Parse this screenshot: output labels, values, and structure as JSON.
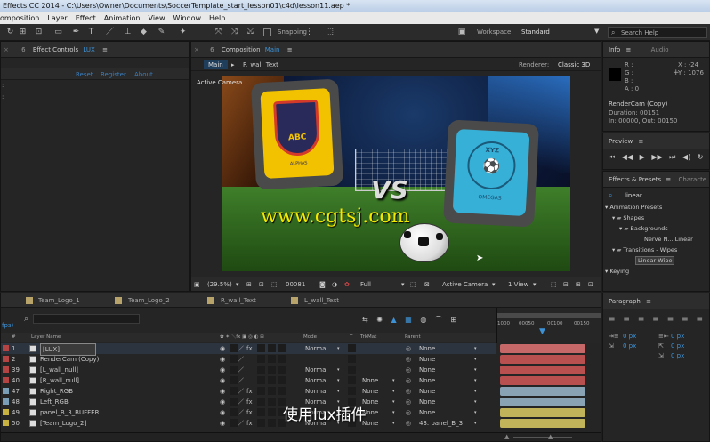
{
  "window": {
    "title": "Effects CC 2014 - C:\\Users\\Owner\\Documents\\SoccerTemplate_start_lesson01\\c4d\\lesson11.aep *"
  },
  "menu": [
    "omposition",
    "Layer",
    "Effect",
    "Animation",
    "View",
    "Window",
    "Help"
  ],
  "toolbar": {
    "snapping": "Snapping",
    "workspace_label": "Workspace:",
    "workspace_value": "Standard",
    "search_placeholder": "Search Help"
  },
  "effect_controls": {
    "tab": "Effect Controls",
    "layer": "LUX",
    "reset": "Reset",
    "register": "Register",
    "about": "About..."
  },
  "composition": {
    "tab": "Composition",
    "comp_name": "Main",
    "sub_tab_main": "Main",
    "sub_tab_other": "R_wall_Text",
    "renderer_label": "Renderer:",
    "renderer_value": "Classic 3D",
    "active_camera": "Active Camera",
    "watermark": "www.cgtsj.com",
    "vs_text": "VS",
    "logo_left": {
      "letters": "ABC",
      "sub": "ALPHAS"
    },
    "logo_right": {
      "letters": "XYZ",
      "sub": "OMEGAS"
    },
    "footer": {
      "zoom": "(29.5%)",
      "frame": "00081",
      "resolution": "Full",
      "view": "Active Camera",
      "views": "1 View"
    }
  },
  "info": {
    "tab": "Info",
    "audio_tab": "Audio",
    "channels": [
      "R :",
      "G :",
      "B :",
      "A : 0"
    ],
    "x": "X : -24",
    "y": "Y : 1076",
    "layer": "RenderCam (Copy)",
    "duration": "Duration: 00151",
    "inout": "In: 00000, Out: 00150"
  },
  "preview": {
    "tab": "Preview"
  },
  "effects_presets": {
    "tab": "Effects & Presets",
    "other_tab": "Characte",
    "search": "linear",
    "tree": [
      "Animation Presets",
      "Shapes",
      "Backgrounds",
      "Nerve N... Linear",
      "Transitions - Wipes",
      "Linear Wipe",
      "Keying"
    ]
  },
  "paragraph": {
    "tab": "Paragraph",
    "values": [
      "0 px",
      "0 px",
      "0 px",
      "0 px",
      "0 px"
    ]
  },
  "timeline": {
    "tabs": [
      "Team_Logo_1",
      "Team_Logo_2",
      "R_wall_Text",
      "L_wall_Text"
    ],
    "fps": "fps)",
    "headers": {
      "num": "#",
      "name": "Layer Name",
      "mode": "Mode",
      "t": "T",
      "trkmat": "TrkMat",
      "parent": "Parent"
    },
    "ruler": [
      "1000",
      "00050",
      "00100",
      "00150"
    ],
    "layers": [
      {
        "num": "1",
        "name": "[LUX]",
        "mode": "Normal",
        "trkmat": "",
        "parent": "None",
        "color": "#b44444",
        "bar": "#c76868"
      },
      {
        "num": "2",
        "name": "RenderCam (Copy)",
        "mode": "",
        "trkmat": "",
        "parent": "None",
        "color": "#b44444",
        "bar": "#b85050"
      },
      {
        "num": "39",
        "name": "[L_wall_null]",
        "mode": "Normal",
        "trkmat": "",
        "parent": "None",
        "color": "#b44444",
        "bar": "#b85050"
      },
      {
        "num": "40",
        "name": "[R_wall_null]",
        "mode": "Normal",
        "trkmat": "None",
        "parent": "None",
        "color": "#b44444",
        "bar": "#b85050"
      },
      {
        "num": "47",
        "name": "Right_RGB",
        "mode": "Normal",
        "trkmat": "None",
        "parent": "None",
        "color": "#7a9eb6",
        "bar": "#8aa3b4"
      },
      {
        "num": "48",
        "name": "Left_RGB",
        "mode": "Normal",
        "trkmat": "None",
        "parent": "None",
        "color": "#7a9eb6",
        "bar": "#8aa3b4"
      },
      {
        "num": "49",
        "name": "panel_B_3_BUFFER",
        "mode": "Normal",
        "trkmat": "None",
        "parent": "None",
        "color": "#c9b340",
        "bar": "#c1b35a"
      },
      {
        "num": "50",
        "name": "[Team_Logo_2]",
        "mode": "Normal",
        "trkmat": "None",
        "parent": "43. panel_B_3",
        "color": "#c9b340",
        "bar": "#c1b35a"
      }
    ]
  },
  "subtitle": "使用lux插件"
}
